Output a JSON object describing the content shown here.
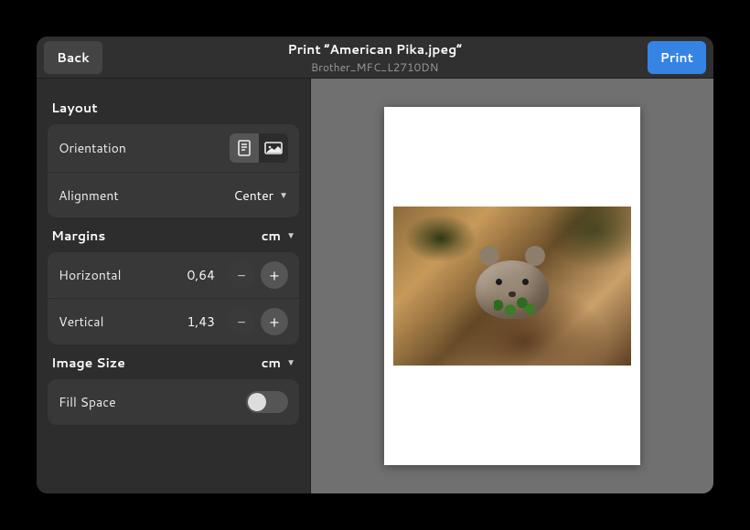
{
  "header": {
    "back_label": "Back",
    "print_label": "Print",
    "title": "Print “American Pika.jpeg”",
    "subtitle": "Brother_MFC_L2710DN"
  },
  "layout": {
    "title": "Layout",
    "orientation_label": "Orientation",
    "orientation": "portrait",
    "alignment_label": "Alignment",
    "alignment_value": "Center"
  },
  "margins": {
    "title": "Margins",
    "unit": "cm",
    "horizontal_label": "Horizontal",
    "horizontal_value": "0,64",
    "vertical_label": "Vertical",
    "vertical_value": "1,43"
  },
  "image_size": {
    "title": "Image Size",
    "unit": "cm",
    "fill_space_label": "Fill Space",
    "fill_space": false
  }
}
